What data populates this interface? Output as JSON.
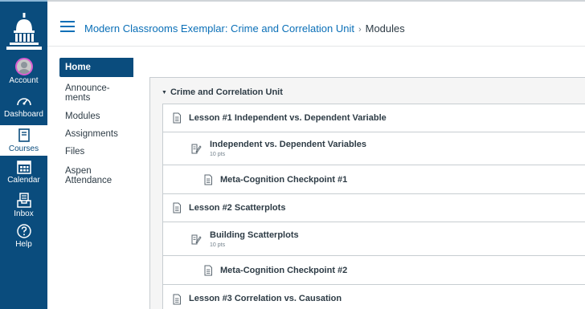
{
  "global_nav": {
    "items": [
      {
        "label": "Account",
        "icon": "account-avatar",
        "active": false
      },
      {
        "label": "Dashboard",
        "icon": "dashboard-icon",
        "active": false
      },
      {
        "label": "Courses",
        "icon": "book-icon",
        "active": true
      },
      {
        "label": "Calendar",
        "icon": "calendar-icon",
        "active": false
      },
      {
        "label": "Inbox",
        "icon": "inbox-icon",
        "active": false
      },
      {
        "label": "Help",
        "icon": "help-icon",
        "active": false
      }
    ]
  },
  "header": {
    "course_link": "Modern Classrooms Exemplar: Crime and Correlation Unit",
    "separator": "›",
    "current": "Modules"
  },
  "course_nav": {
    "items": [
      {
        "label": "Home",
        "active": true
      },
      {
        "label": "Announce-\nments",
        "active": false
      },
      {
        "label": "Modules",
        "active": false
      },
      {
        "label": "Assignments",
        "active": false
      },
      {
        "label": "Files",
        "active": false
      },
      {
        "label": "Aspen Attendance",
        "active": false
      }
    ]
  },
  "module": {
    "title": "Crime and Correlation Unit",
    "items": [
      {
        "title": "Lesson #1 Independent vs. Dependent Variable",
        "type": "page",
        "indent": 0
      },
      {
        "title": "Independent vs. Dependent Variables",
        "points": "10 pts",
        "type": "assignment",
        "indent": 1
      },
      {
        "title": "Meta-Cognition Checkpoint #1",
        "type": "page",
        "indent": 1
      },
      {
        "title": "Lesson #2 Scatterplots",
        "type": "page",
        "indent": 0
      },
      {
        "title": "Building Scatterplots",
        "points": "10 pts",
        "type": "assignment",
        "indent": 1
      },
      {
        "title": "Meta-Cognition Checkpoint #2",
        "type": "page",
        "indent": 1
      },
      {
        "title": "Lesson #3 Correlation vs. Causation",
        "type": "page",
        "indent": 0
      }
    ]
  },
  "colors": {
    "nav_bg": "#0a4c7d",
    "link": "#0a6fb7",
    "text": "#2d3b45",
    "avatar_ring": "#d85dd0"
  }
}
